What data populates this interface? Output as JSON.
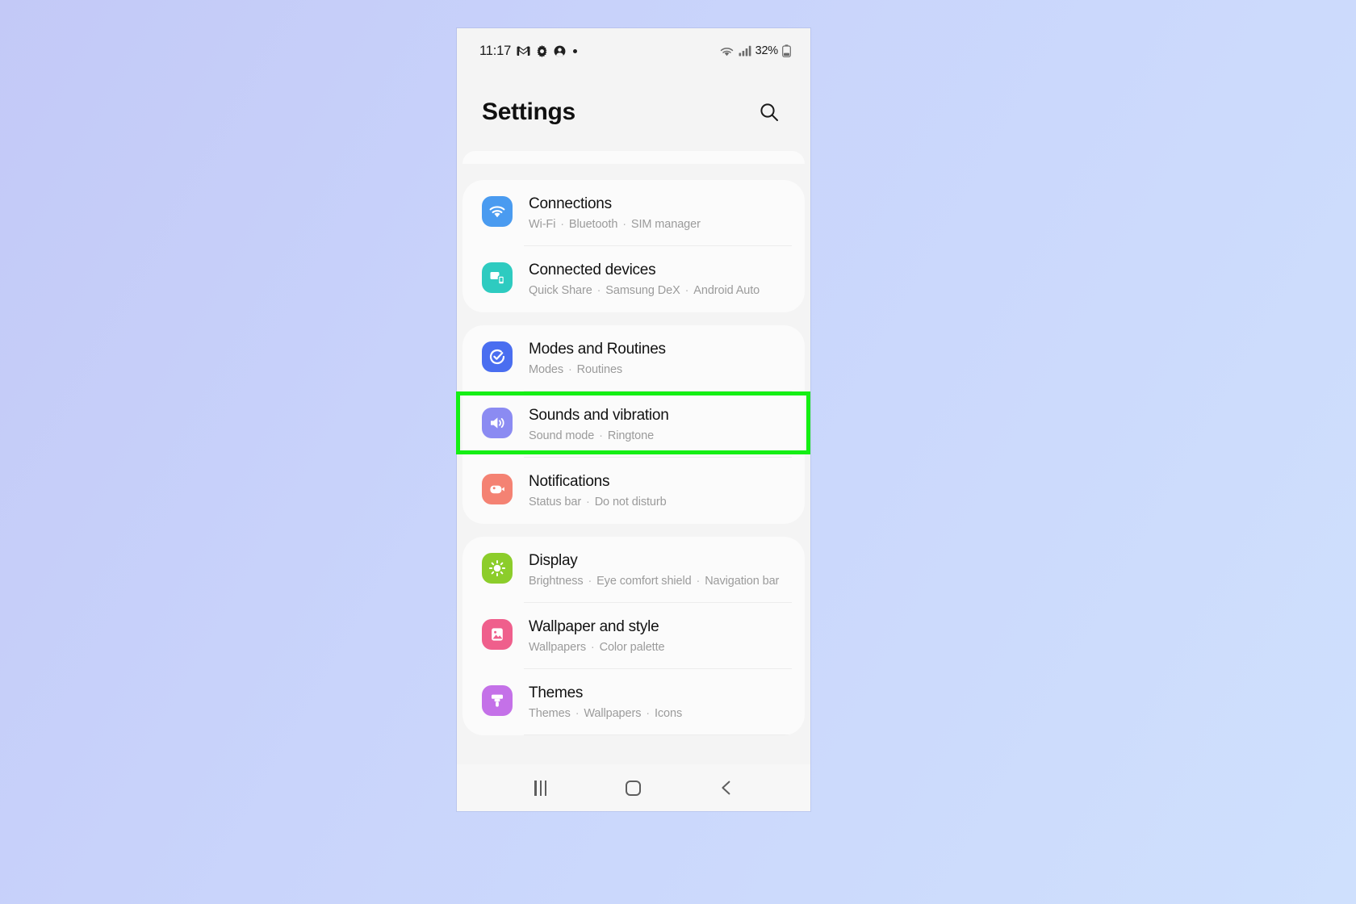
{
  "status_bar": {
    "time": "11:17",
    "left_icons": [
      "gmail-icon",
      "gear-icon",
      "account-icon",
      "dot-indicator"
    ],
    "battery_text": "32%",
    "right_icons": [
      "wifi-icon",
      "cellular-signal-icon",
      "battery-icon"
    ]
  },
  "header": {
    "title": "Settings",
    "search_icon": "search-icon"
  },
  "groups": [
    {
      "items": [
        {
          "icon": "wifi-icon",
          "icon_color": "#4a9bf0",
          "title": "Connections",
          "subtitle_parts": [
            "Wi-Fi",
            "Bluetooth",
            "SIM manager"
          ]
        },
        {
          "icon": "connected-devices-icon",
          "icon_color": "#2ecbc0",
          "title": "Connected devices",
          "subtitle_parts": [
            "Quick Share",
            "Samsung DeX",
            "Android Auto"
          ]
        }
      ]
    },
    {
      "items": [
        {
          "icon": "modes-routines-icon",
          "icon_color": "#4a6ef0",
          "title": "Modes and Routines",
          "subtitle_parts": [
            "Modes",
            "Routines"
          ]
        },
        {
          "icon": "sound-icon",
          "icon_color": "#8b8bf2",
          "title": "Sounds and vibration",
          "subtitle_parts": [
            "Sound mode",
            "Ringtone"
          ],
          "highlighted": true
        },
        {
          "icon": "notifications-icon",
          "icon_color": "#f48273",
          "title": "Notifications",
          "subtitle_parts": [
            "Status bar",
            "Do not disturb"
          ]
        }
      ]
    },
    {
      "items": [
        {
          "icon": "brightness-icon",
          "icon_color": "#8ccd2b",
          "title": "Display",
          "subtitle_parts": [
            "Brightness",
            "Eye comfort shield",
            "Navigation bar"
          ]
        },
        {
          "icon": "wallpaper-icon",
          "icon_color": "#ef5f8c",
          "title": "Wallpaper and style",
          "subtitle_parts": [
            "Wallpapers",
            "Color palette"
          ]
        },
        {
          "icon": "themes-icon",
          "icon_color": "#c471e8",
          "title": "Themes",
          "subtitle_parts": [
            "Themes",
            "Wallpapers",
            "Icons"
          ]
        }
      ]
    }
  ],
  "nav_bar": {
    "recents_label": "recents-icon",
    "home_label": "home-icon",
    "back_label": "back-icon"
  },
  "annotation": {
    "highlight_color": "#14ef14",
    "highlight_target": "Sounds and vibration"
  }
}
